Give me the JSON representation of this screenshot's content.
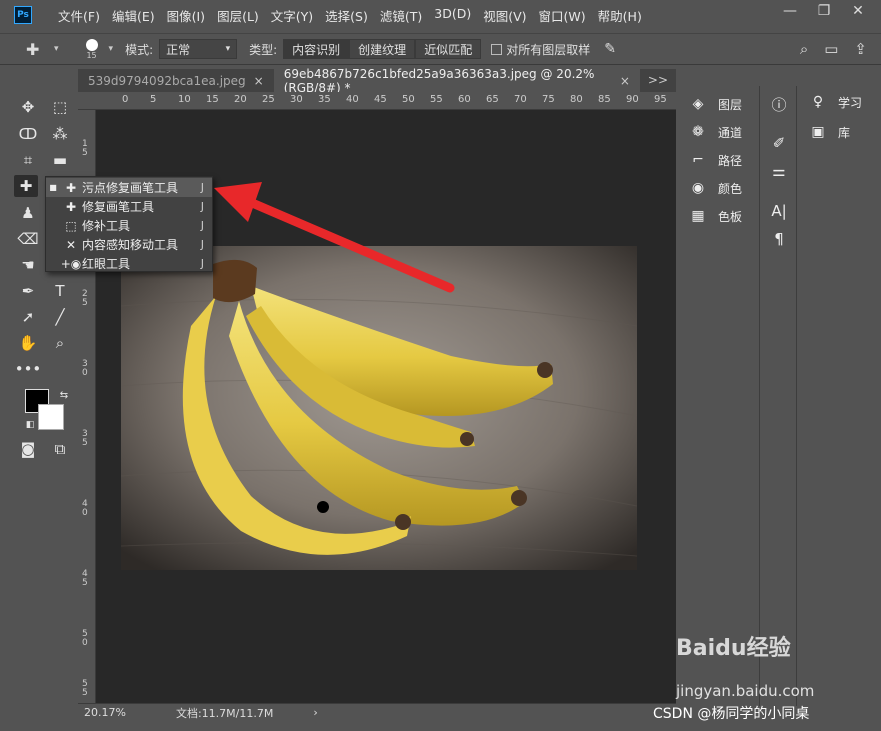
{
  "app": {
    "logo": "Ps"
  },
  "menu": [
    "文件(F)",
    "编辑(E)",
    "图像(I)",
    "图层(L)",
    "文字(Y)",
    "选择(S)",
    "滤镜(T)",
    "3D(D)",
    "视图(V)",
    "窗口(W)",
    "帮助(H)"
  ],
  "window_controls": {
    "minimize": "—",
    "restore": "❐",
    "close": "✕"
  },
  "options": {
    "brush_size": "15",
    "mode_label": "模式:",
    "mode_value": "正常",
    "type_label": "类型:",
    "types": [
      "内容识别",
      "创建纹理",
      "近似匹配"
    ],
    "sample_all_label": "对所有图层取样"
  },
  "tabs": [
    {
      "label": "539d9794092bca1ea.jpeg",
      "close": "×"
    },
    {
      "label": "69eb4867b726c1bfed25a9a36363a3.jpeg @ 20.2%(RGB/8#) *",
      "close": "×"
    }
  ],
  "tab_overflow": ">>",
  "ruler_top": [
    "0",
    "5",
    "10",
    "15",
    "20",
    "25",
    "30",
    "35",
    "40",
    "45",
    "50",
    "55",
    "60",
    "65",
    "70",
    "75",
    "80",
    "85",
    "90",
    "95"
  ],
  "ruler_left": [
    "1\n5",
    "2\n0",
    "2\n5",
    "3\n0",
    "3\n5",
    "4\n0",
    "4\n5",
    "5\n0",
    "5\n5"
  ],
  "flyout": [
    {
      "label": "污点修复画笔工具",
      "key": "J",
      "icon": "spot-healing-icon",
      "glyph": "✚",
      "selected": true
    },
    {
      "label": "修复画笔工具",
      "key": "J",
      "icon": "healing-brush-icon",
      "glyph": "✚",
      "selected": false
    },
    {
      "label": "修补工具",
      "key": "J",
      "icon": "patch-icon",
      "glyph": "⬚",
      "selected": false
    },
    {
      "label": "内容感知移动工具",
      "key": "J",
      "icon": "content-aware-move-icon",
      "glyph": "✕",
      "selected": false
    },
    {
      "label": "红眼工具",
      "key": "J",
      "icon": "red-eye-icon",
      "glyph": "+◉",
      "selected": false
    }
  ],
  "status": {
    "zoom": "20.17%",
    "doc": "文档:11.7M/11.7M",
    "arrow": "›"
  },
  "panels_left": [
    {
      "label": "图层",
      "icon": "layers-icon",
      "glyph": "◈"
    },
    {
      "label": "通道",
      "icon": "channels-icon",
      "glyph": "❁"
    },
    {
      "label": "路径",
      "icon": "paths-icon",
      "glyph": "⌐"
    },
    {
      "label": "颜色",
      "icon": "color-icon",
      "glyph": "◉"
    },
    {
      "label": "色板",
      "icon": "swatches-icon",
      "glyph": "▦"
    }
  ],
  "panels_right": [
    {
      "label": "学习",
      "icon": "learn-icon",
      "glyph": "♀"
    },
    {
      "label": "库",
      "icon": "libraries-icon",
      "glyph": "▣"
    }
  ],
  "watermark": {
    "baidu": "Baidu经验",
    "jingyan": "jingyan.baidu.com",
    "csdn": "CSDN @杨同学的小同桌"
  },
  "colors": {
    "bg": "#535353",
    "canvas": "#282828",
    "arrow": "#e8282a"
  }
}
